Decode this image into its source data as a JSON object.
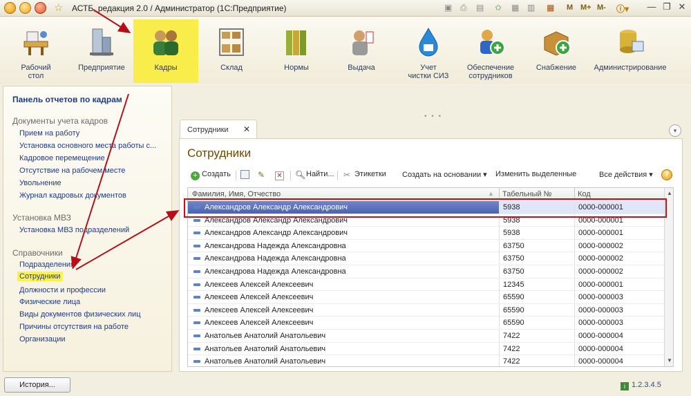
{
  "window": {
    "title": "АСТБ, редакция 2.0 / Администратор  (1С:Предприятие)",
    "mem_buttons": [
      "M",
      "M+",
      "M-"
    ],
    "info_icon": "info-icon"
  },
  "sections": [
    {
      "label": "Рабочий\nстол",
      "icon": "desktop-icon"
    },
    {
      "label": "Предприятие",
      "icon": "enterprise-icon"
    },
    {
      "label": "Кадры",
      "icon": "staff-icon",
      "active": true
    },
    {
      "label": "Склад",
      "icon": "warehouse-icon"
    },
    {
      "label": "Нормы",
      "icon": "norms-icon"
    },
    {
      "label": "Выдача",
      "icon": "issue-icon"
    },
    {
      "label": "Учет\nчистки СИЗ",
      "icon": "cleaning-icon"
    },
    {
      "label": "Обеспечение\nсотрудников",
      "icon": "supply-staff-icon"
    },
    {
      "label": "Снабжение",
      "icon": "procurement-icon"
    },
    {
      "label": "Администрирование",
      "icon": "admin-icon"
    }
  ],
  "left_panel": {
    "title": "Панель отчетов по кадрам",
    "groups": [
      {
        "title": "Документы учета кадров",
        "items": [
          "Прием на работу",
          "Установка основного места работы с...",
          "Кадровое перемещение",
          "Отсутствие на рабочем месте",
          "Увольнение",
          "Журнал кадровых документов"
        ]
      },
      {
        "title": "Установка МВЗ",
        "items": [
          "Установка МВЗ подразделений"
        ]
      },
      {
        "title": "Справочники",
        "items": [
          "Подразделения",
          "Сотрудники",
          "Должности и профессии",
          "Физические лица",
          "Виды документов физических лиц",
          "Причины отсутствия на работе",
          "Организации"
        ]
      }
    ],
    "highlighted_item": "Сотрудники"
  },
  "form": {
    "tab_label": "Сотрудники",
    "title": "Сотрудники",
    "commands": {
      "create": "Создать",
      "find": "Найти...",
      "labels": "Этикетки",
      "create_based_on": "Создать на основании",
      "change_selected": "Изменить выделенные",
      "all_actions": "Все действия"
    },
    "columns": [
      "Фамилия, Имя, Отчество",
      "Табельный №",
      "Код"
    ],
    "rows": [
      {
        "name": "Александров Александр Александрович",
        "tab_no": "5938",
        "code": "0000-000001",
        "selected": true
      },
      {
        "name": "Александров Александр Александрович",
        "tab_no": "5938",
        "code": "0000-000001"
      },
      {
        "name": "Александров Александр Александрович",
        "tab_no": "5938",
        "code": "0000-000001"
      },
      {
        "name": "Александрова Надежда Александровна",
        "tab_no": "63750",
        "code": "0000-000002"
      },
      {
        "name": "Александрова Надежда Александровна",
        "tab_no": "63750",
        "code": "0000-000002"
      },
      {
        "name": "Александрова Надежда Александровна",
        "tab_no": "63750",
        "code": "0000-000002"
      },
      {
        "name": "Алексеев Алексей Алексеевич",
        "tab_no": "12345",
        "code": "0000-000001"
      },
      {
        "name": "Алексеев Алексей Алексеевич",
        "tab_no": "65590",
        "code": "0000-000003"
      },
      {
        "name": "Алексеев Алексей Алексеевич",
        "tab_no": "65590",
        "code": "0000-000003"
      },
      {
        "name": "Алексеев Алексей Алексеевич",
        "tab_no": "65590",
        "code": "0000-000003"
      },
      {
        "name": "Анатольев Анатолий Анатольевич",
        "tab_no": "7422",
        "code": "0000-000004"
      },
      {
        "name": "Анатольев Анатолий Анатольевич",
        "tab_no": "7422",
        "code": "0000-000004"
      },
      {
        "name": "Анатольев Анатолий Анатольевич",
        "tab_no": "7422",
        "code": "0000-000004"
      }
    ]
  },
  "status": {
    "history_button": "История...",
    "version": "1.2.3.4.5"
  },
  "colors": {
    "accent_active_section": "#f8ed4a",
    "selected_row": "#4b63b0",
    "annotation": "#c0141d",
    "link": "#1d3a8a",
    "form_title": "#6d4900"
  }
}
